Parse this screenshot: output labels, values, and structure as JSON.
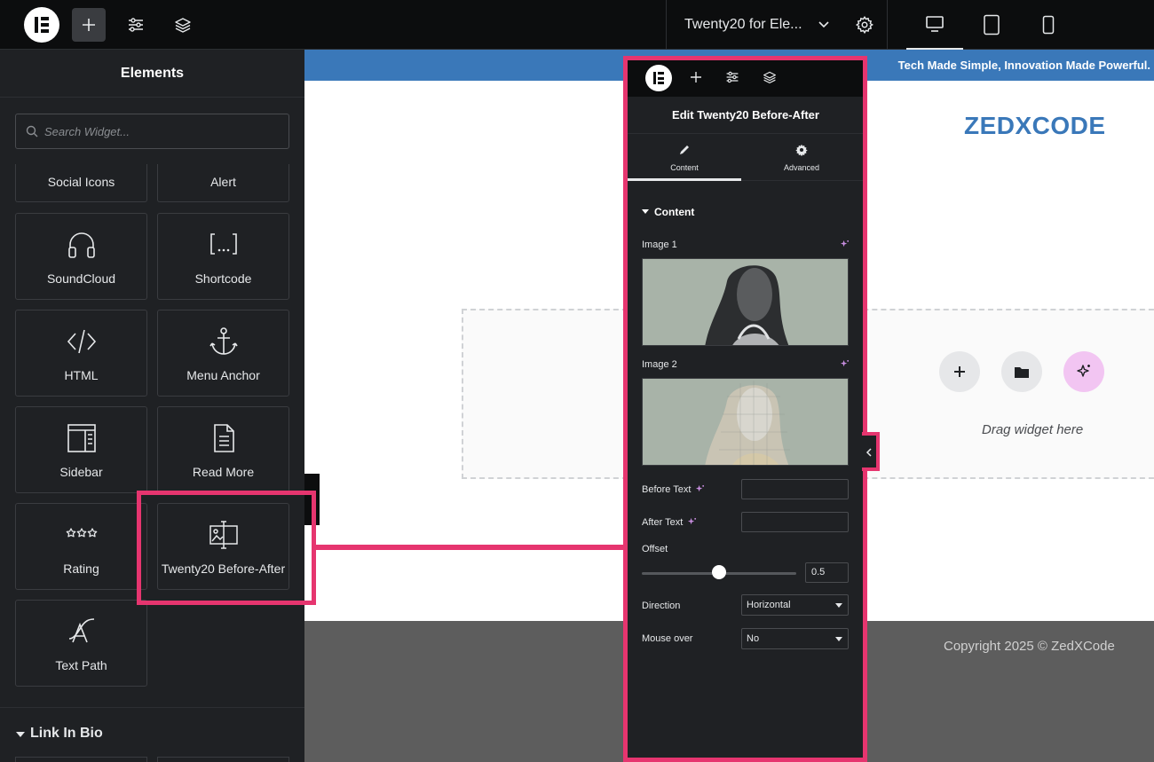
{
  "topbar": {
    "doc_title": "Twenty20 for Ele...",
    "buttons": [
      "add-element",
      "site-settings",
      "structure"
    ],
    "devices": [
      "desktop",
      "tablet",
      "mobile"
    ]
  },
  "left_panel": {
    "title": "Elements",
    "search_placeholder": "Search Widget...",
    "widgets": [
      {
        "label": "Social Icons",
        "icon": "none"
      },
      {
        "label": "Alert",
        "icon": "none"
      },
      {
        "label": "SoundCloud",
        "icon": "headphones-icon"
      },
      {
        "label": "Shortcode",
        "icon": "shortcode-icon"
      },
      {
        "label": "HTML",
        "icon": "code-icon"
      },
      {
        "label": "Menu Anchor",
        "icon": "anchor-icon"
      },
      {
        "label": "Sidebar",
        "icon": "sidebar-icon"
      },
      {
        "label": "Read More",
        "icon": "document-icon"
      },
      {
        "label": "Rating",
        "icon": "stars-icon"
      },
      {
        "label": "Twenty20 Before-After",
        "icon": "before-after-icon"
      },
      {
        "label": "Text Path",
        "icon": "text-path-icon"
      }
    ],
    "section_title": "Link In Bio"
  },
  "canvas": {
    "tagline": "Tech Made Simple, Innovation Made Powerful.",
    "brand": "ZEDXCODE",
    "drag_text": "Drag widget here",
    "footer_text": "Copyright 2025 © ZedXCode"
  },
  "edit_panel": {
    "title": "Edit Twenty20 Before-After",
    "tabs": [
      {
        "label": "Content",
        "icon": "pencil-icon",
        "active": true
      },
      {
        "label": "Advanced",
        "icon": "gear-icon",
        "active": false
      }
    ],
    "section": "Content",
    "image1_label": "Image 1",
    "image2_label": "Image 2",
    "before_text_label": "Before Text",
    "before_text_value": "",
    "after_text_label": "After Text",
    "after_text_value": "",
    "offset_label": "Offset",
    "offset_value": "0.5",
    "direction_label": "Direction",
    "direction_value": "Horizontal",
    "mouse_over_label": "Mouse over",
    "mouse_over_value": "No"
  },
  "colors": {
    "highlight": "#e6356f",
    "brand_blue": "#3a78b9",
    "panel_bg": "#1f2124",
    "topbar_bg": "#0c0d0e"
  }
}
